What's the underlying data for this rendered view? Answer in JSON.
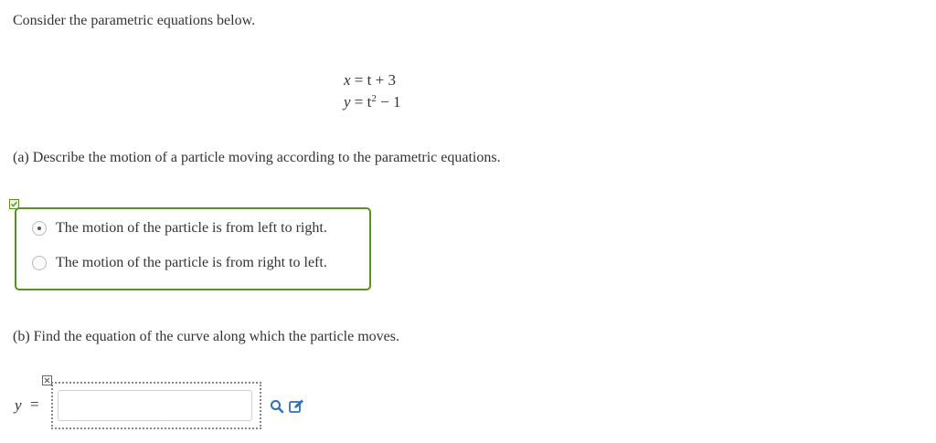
{
  "intro": "Consider the parametric equations below.",
  "equations": {
    "x_var": "x",
    "x_rhs": "= t + 3",
    "y_var": "y",
    "y_rhs_a": "= t",
    "y_exp": "2",
    "y_rhs_b": "− 1"
  },
  "part_a": {
    "label": "(a)",
    "question": "Describe the motion of a particle moving according to the parametric equations.",
    "options": [
      {
        "text": "The motion of the particle is from left to right.",
        "selected": true
      },
      {
        "text": "The motion of the particle is from right to left.",
        "selected": false
      }
    ]
  },
  "part_b": {
    "label": "(b)",
    "question": "Find the equation of the curve along which the particle moves.",
    "answer_var": "y",
    "equals": "=",
    "answer_value": ""
  },
  "colors": {
    "correct_border": "#5a8f22",
    "tool_icon": "#2f6fb5"
  },
  "icons": {
    "correct": "checkmark-icon",
    "incorrect": "x-mark-icon",
    "preview": "magnifier-icon",
    "edit": "pencil-edit-icon"
  }
}
